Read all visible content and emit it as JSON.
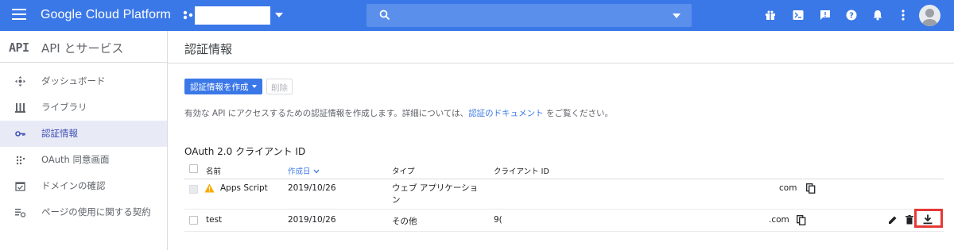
{
  "topbar": {
    "brand": "Google Cloud Platform",
    "icons": [
      "menu-icon",
      "project-dots-icon",
      "search-icon",
      "gift-icon",
      "terminal-icon",
      "feedback-icon",
      "help-icon",
      "notifications-icon",
      "more-vert-icon",
      "account-icon"
    ],
    "color": "#3b78e7"
  },
  "sidebar": {
    "logo": "API",
    "title": "API とサービス",
    "items": [
      {
        "label": "ダッシュボード",
        "icon": "dashboard-icon"
      },
      {
        "label": "ライブラリ",
        "icon": "library-icon"
      },
      {
        "label": "認証情報",
        "icon": "key-icon",
        "active": true
      },
      {
        "label": "OAuth 同意画面",
        "icon": "oauth-consent-icon"
      },
      {
        "label": "ドメインの確認",
        "icon": "domain-check-icon"
      },
      {
        "label": "ページの使用に関する契約",
        "icon": "settings-list-icon"
      }
    ]
  },
  "main": {
    "title": "認証情報",
    "create_button": "認証情報を作成",
    "delete_button": "削除",
    "description_prefix": "有効な API にアクセスするための認証情報を作成します。詳細については、",
    "description_link": "認証のドキュメント",
    "description_suffix": " をご覧ください。",
    "section_title": "OAuth 2.0 クライアント ID"
  },
  "table": {
    "columns": {
      "name": "名前",
      "created": "作成日",
      "type": "タイプ",
      "client_id": "クライアント ID"
    },
    "rows": [
      {
        "name": "Apps Script",
        "created": "2019/10/26",
        "type": "ウェブ アプリケーション",
        "client_id_suffix": "com",
        "warning": true
      },
      {
        "name": "test",
        "created": "2019/10/26",
        "type": "その他",
        "client_id_prefix": "9(",
        "client_id_suffix": ".com",
        "warning": false
      }
    ]
  }
}
